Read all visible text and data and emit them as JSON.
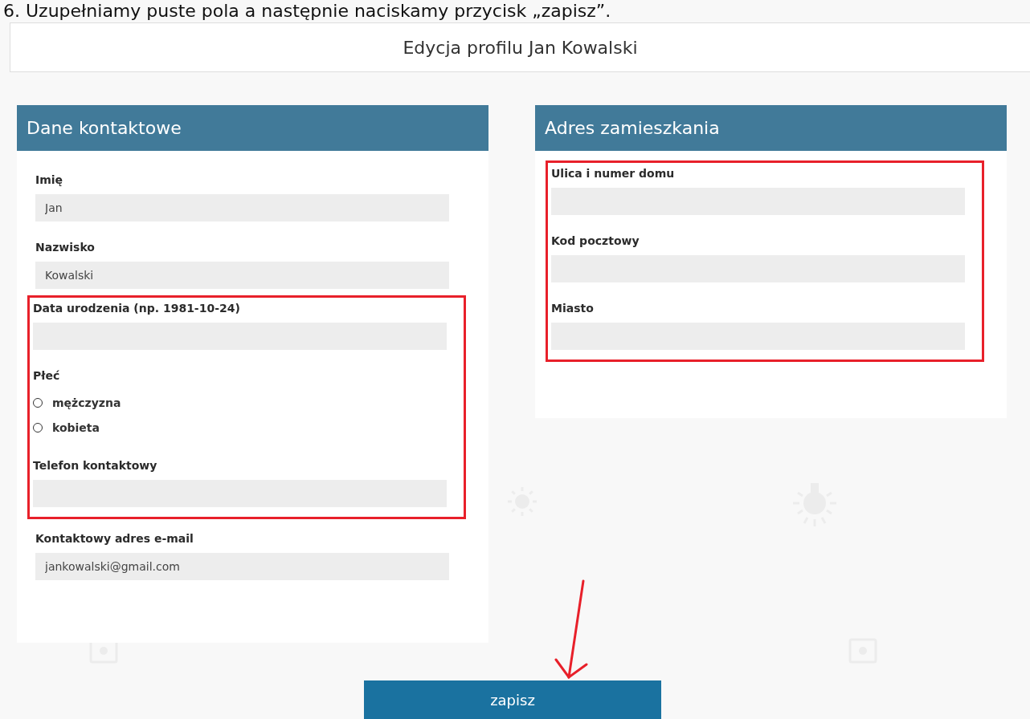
{
  "instruction": "6. Uzupełniamy puste pola a następnie naciskamy przycisk „zapisz”.",
  "page_title": "Edycja profilu Jan Kowalski",
  "panels": [
    {
      "title": "Dane kontaktowe",
      "sections": [
        {
          "highlighted": false,
          "fields": [
            {
              "kind": "text",
              "label": "Imię",
              "value": "Jan"
            },
            {
              "kind": "text",
              "label": "Nazwisko",
              "value": "Kowalski"
            }
          ]
        },
        {
          "highlighted": true,
          "fields": [
            {
              "kind": "text",
              "label": "Data urodzenia (np. 1981-10-24)"
            },
            {
              "kind": "radio",
              "label": "Płeć",
              "options": [
                {
                  "label": "mężczyzna",
                  "selected": false
                },
                {
                  "label": "kobieta",
                  "selected": false
                }
              ]
            },
            {
              "kind": "text",
              "label": "Telefon kontaktowy"
            }
          ]
        },
        {
          "highlighted": false,
          "fields": [
            {
              "kind": "text",
              "label": "Kontaktowy adres e-mail",
              "value": "jankowalski@gmail.com"
            }
          ]
        }
      ]
    },
    {
      "title": "Adres zamieszkania",
      "sections": [
        {
          "highlighted": true,
          "fields": [
            {
              "kind": "text",
              "label": "Ulica i numer domu"
            },
            {
              "kind": "text",
              "label": "Kod pocztowy"
            },
            {
              "kind": "text",
              "label": "Miasto"
            }
          ]
        }
      ]
    }
  ],
  "save_button": "zapisz"
}
